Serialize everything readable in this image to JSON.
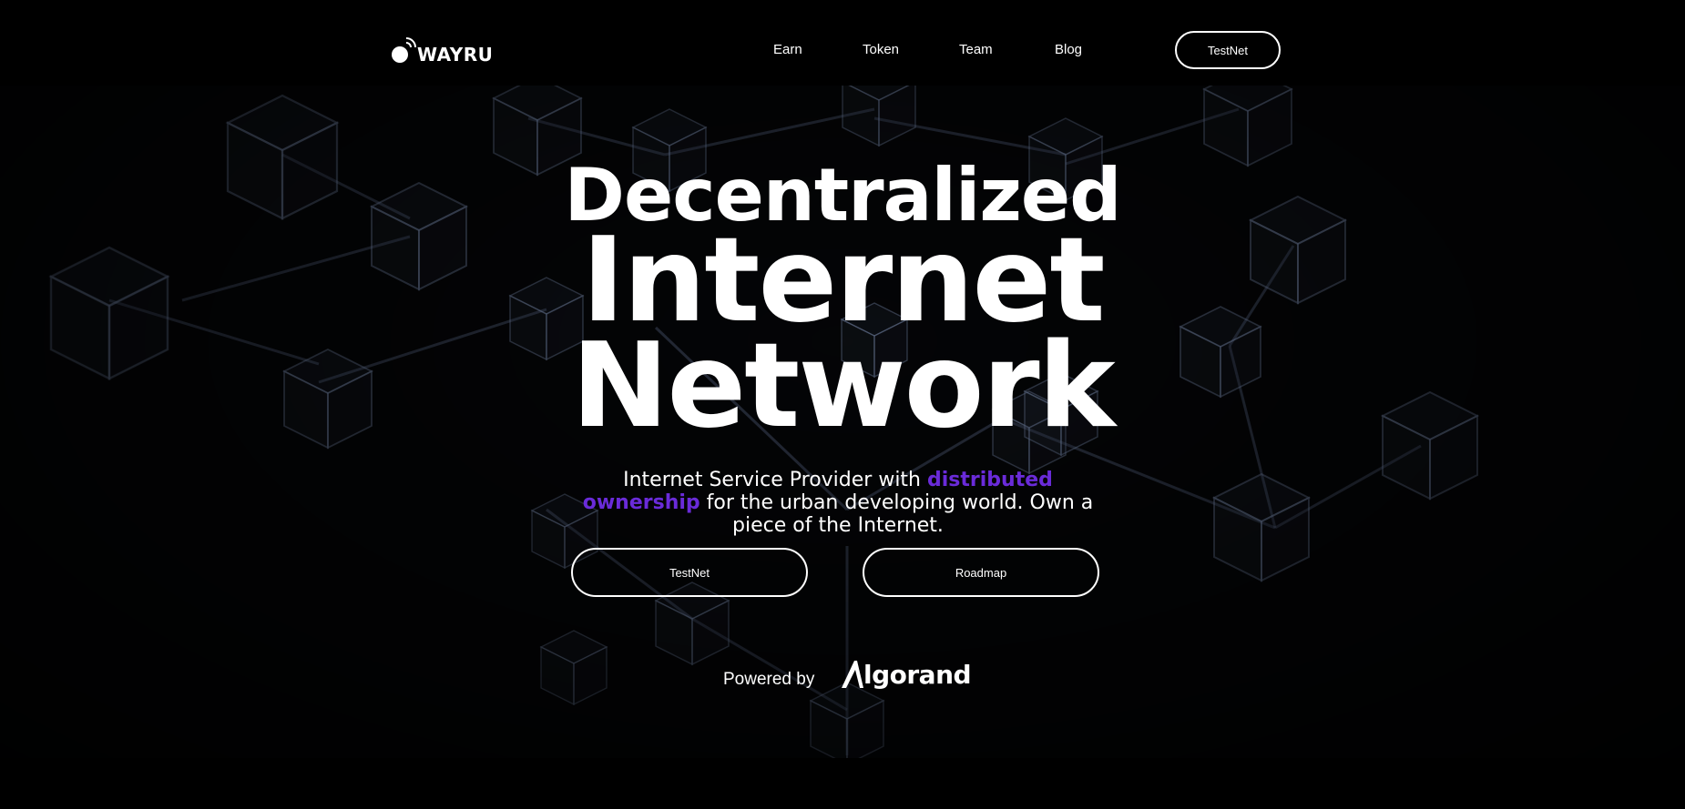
{
  "brand": {
    "name": "WAYRU"
  },
  "nav": {
    "items": [
      {
        "label": "Earn"
      },
      {
        "label": "Token"
      },
      {
        "label": "Team"
      },
      {
        "label": "Blog"
      }
    ],
    "cta_label": "TestNet"
  },
  "hero": {
    "line1": "Decentralized",
    "line2": "Internet",
    "line3": "Network",
    "subtitle_before": "Internet Service Provider with ",
    "subtitle_highlight": "distributed ownership",
    "subtitle_after": " for the urban developing world. Own a piece of the Internet.",
    "buttons": [
      {
        "label": "TestNet"
      },
      {
        "label": "Roadmap"
      }
    ],
    "powered_by": "Powered by",
    "partner_logo_text": "lgorand"
  },
  "colors": {
    "highlight": "#6a2bd9",
    "background": "#000000",
    "text": "#ffffff"
  },
  "icons": [
    "wifi-signal-icon",
    "algorand-logo"
  ]
}
